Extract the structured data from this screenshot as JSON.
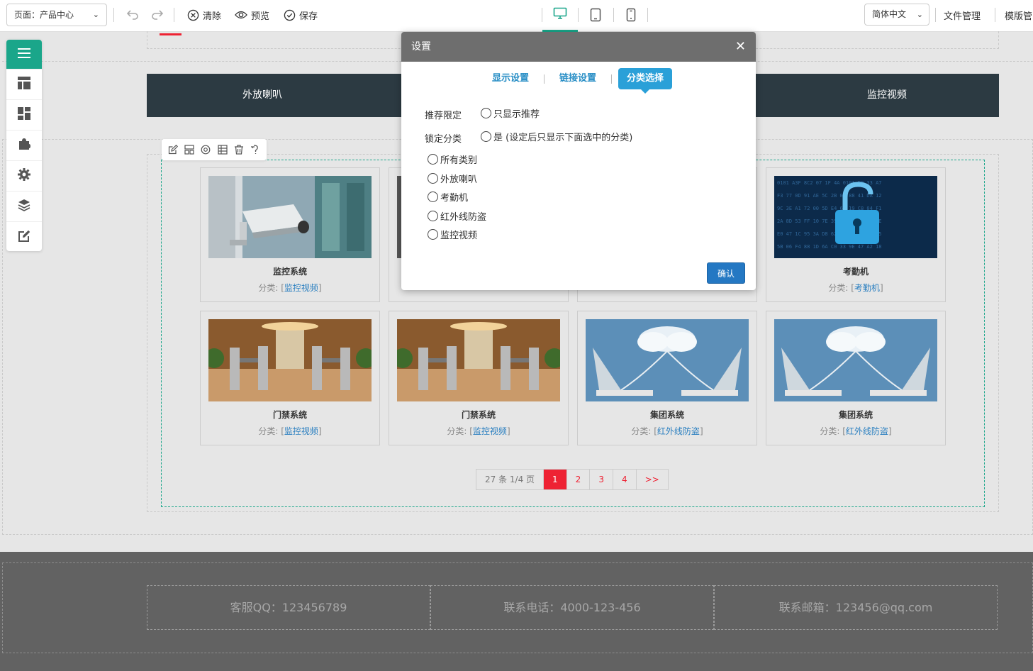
{
  "toolbar": {
    "page_select": "页面：产品中心",
    "clear_label": "清除",
    "preview_label": "预览",
    "save_label": "保存",
    "lang_select": "简体中文",
    "file_manage": "文件管理",
    "template_manage": "模版管"
  },
  "nav": {
    "items": [
      "外放喇叭",
      "监控视频"
    ]
  },
  "products": [
    {
      "title": "监控系统",
      "cat_prefix": "分类: [",
      "cat": "监控视频",
      "cat_suffix": "]",
      "image": "security-camera"
    },
    {
      "title": "",
      "cat_prefix": "",
      "cat": "",
      "cat_suffix": "",
      "image": "hidden"
    },
    {
      "title": "",
      "cat_prefix": "",
      "cat": "",
      "cat_suffix": "",
      "image": "hidden"
    },
    {
      "title": "考勤机",
      "cat_prefix": "分类: [",
      "cat": "考勤机",
      "cat_suffix": "]",
      "image": "digital-lock"
    },
    {
      "title": "门禁系统",
      "cat_prefix": "分类: [",
      "cat": "监控视频",
      "cat_suffix": "]",
      "image": "turnstile-gates"
    },
    {
      "title": "门禁系统",
      "cat_prefix": "分类: [",
      "cat": "监控视频",
      "cat_suffix": "]",
      "image": "turnstile-gates"
    },
    {
      "title": "集团系统",
      "cat_prefix": "分类: [",
      "cat": "红外线防盗",
      "cat_suffix": "]",
      "image": "cloud-laptops"
    },
    {
      "title": "集团系统",
      "cat_prefix": "分类: [",
      "cat": "红外线防盗",
      "cat_suffix": "]",
      "image": "cloud-laptops"
    }
  ],
  "pager": {
    "info": "27 条 1/4 页",
    "pages": [
      "1",
      "2",
      "3",
      "4"
    ],
    "next": ">>",
    "current": "1"
  },
  "footer": {
    "qq": "客服QQ：123456789",
    "phone": "联系电话：4000-123-456",
    "email": "联系邮箱：123456@qq.com"
  },
  "modal": {
    "title": "设置",
    "close": "✕",
    "tabs": [
      "显示设置",
      "链接设置",
      "分类选择"
    ],
    "active_tab": "分类选择",
    "recommend_label": "推荐限定",
    "recommend_option": "只显示推荐",
    "lock_label": "锁定分类",
    "lock_option": "是 (设定后只显示下面选中的分类)",
    "categories": [
      "所有类别",
      "外放喇叭",
      "考勤机",
      "红外线防盗",
      "监控视频"
    ],
    "confirm": "确认"
  },
  "colors": {
    "accent": "#1aa68a",
    "nav_bg": "#2c3a42",
    "pager_active": "#e23333",
    "link": "#2a7fc0",
    "modal_header": "#6e6e6e",
    "confirm": "#2478c3"
  }
}
